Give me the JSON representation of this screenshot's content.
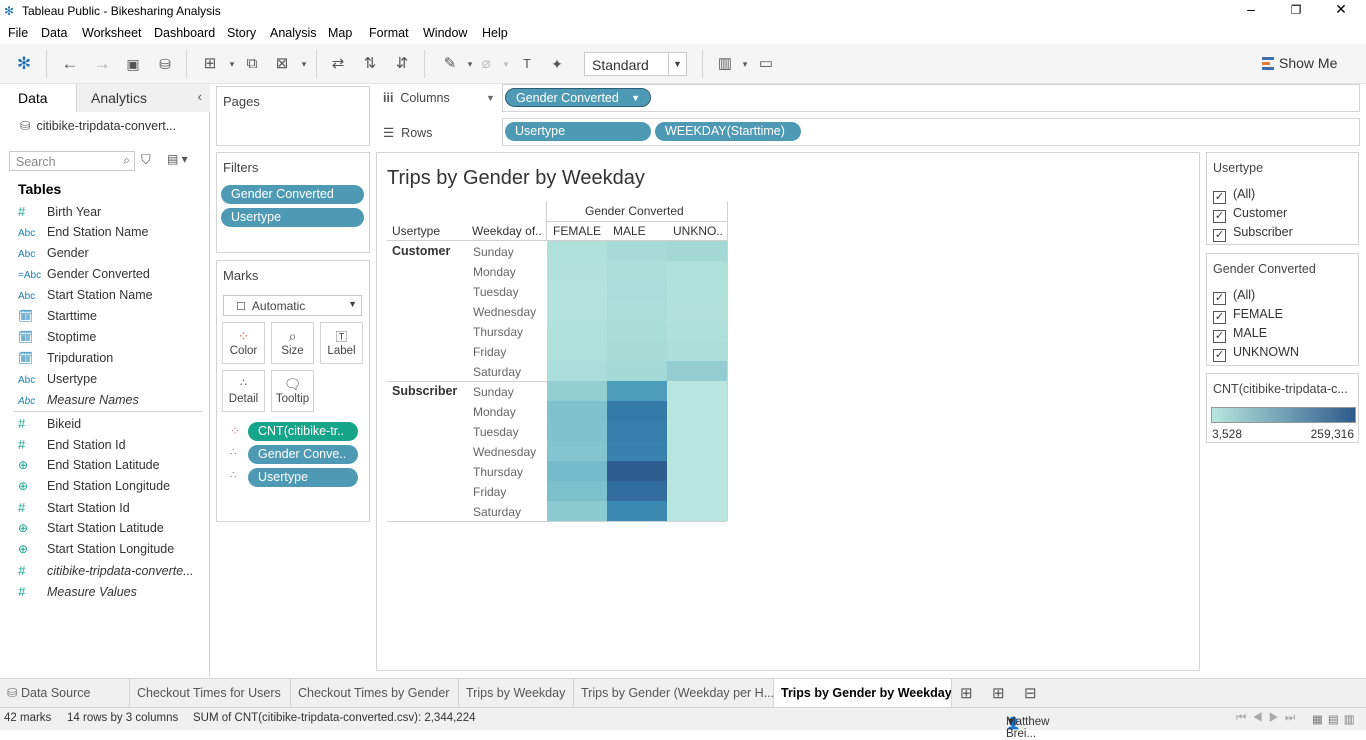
{
  "window": {
    "title": "Tableau Public - Bikesharing Analysis",
    "minimize": "–",
    "restore": "❐",
    "close": "✕"
  },
  "menu": [
    "File",
    "Data",
    "Worksheet",
    "Dashboard",
    "Story",
    "Analysis",
    "Map",
    "Format",
    "Window",
    "Help"
  ],
  "toolbar": {
    "fit": "Standard",
    "show_me": "Show Me"
  },
  "data_pane": {
    "tab_data": "Data",
    "tab_analytics": "Analytics",
    "datasource": "citibike-tripdata-convert...",
    "search_placeholder": "Search",
    "tables_heading": "Tables",
    "dimensions": [
      {
        "type": "num",
        "glyph": "#",
        "name": "Birth Year"
      },
      {
        "type": "str",
        "glyph": "Abc",
        "name": "End Station Name"
      },
      {
        "type": "str",
        "glyph": "Abc",
        "name": "Gender"
      },
      {
        "type": "str",
        "glyph": "=Abc",
        "name": "Gender Converted"
      },
      {
        "type": "str",
        "glyph": "Abc",
        "name": "Start Station Name"
      },
      {
        "type": "dt",
        "glyph": "🗓",
        "name": "Starttime"
      },
      {
        "type": "dt",
        "glyph": "🗓",
        "name": "Stoptime"
      },
      {
        "type": "dt",
        "glyph": "🗓",
        "name": "Tripduration"
      },
      {
        "type": "str",
        "glyph": "Abc",
        "name": "Usertype"
      },
      {
        "type": "str",
        "glyph": "Abc",
        "name": "Measure Names",
        "italic": true
      }
    ],
    "measures": [
      {
        "type": "num",
        "glyph": "#",
        "name": "Bikeid"
      },
      {
        "type": "num",
        "glyph": "#",
        "name": "End Station Id"
      },
      {
        "type": "geo",
        "glyph": "⊕",
        "name": "End Station Latitude"
      },
      {
        "type": "geo",
        "glyph": "⊕",
        "name": "End Station Longitude"
      },
      {
        "type": "num",
        "glyph": "#",
        "name": "Start Station Id"
      },
      {
        "type": "geo",
        "glyph": "⊕",
        "name": "Start Station Latitude"
      },
      {
        "type": "geo",
        "glyph": "⊕",
        "name": "Start Station Longitude"
      },
      {
        "type": "num",
        "glyph": "#",
        "name": "citibike-tripdata-converte...",
        "italic": true
      },
      {
        "type": "num",
        "glyph": "#",
        "name": "Measure Values",
        "italic": true
      }
    ]
  },
  "pages": {
    "heading": "Pages"
  },
  "filters": {
    "heading": "Filters",
    "items": [
      "Gender Converted",
      "Usertype"
    ]
  },
  "marks": {
    "heading": "Marks",
    "type": "Automatic",
    "buttons": [
      "Color",
      "Size",
      "Label",
      "Detail",
      "Tooltip"
    ],
    "pills": [
      "CNT(citibike-tr..",
      "Gender Conve..",
      "Usertype"
    ]
  },
  "columns": {
    "label": "Columns",
    "pill": "Gender Converted"
  },
  "rows": {
    "label": "Rows",
    "pills": [
      "Usertype",
      "WEEKDAY(Starttime)"
    ]
  },
  "viz": {
    "title": "Trips by Gender by Weekday",
    "col_group_header": "Gender Converted",
    "row_header_1": "Usertype",
    "row_header_2": "Weekday of..",
    "columns": [
      "FEMALE",
      "MALE",
      "UNKNO.."
    ],
    "groups": [
      {
        "name": "Customer",
        "days": [
          "Sunday",
          "Monday",
          "Tuesday",
          "Wednesday",
          "Thursday",
          "Friday",
          "Saturday"
        ],
        "colors": [
          [
            "#b0e1db",
            "#a7dbd7",
            "#a3d8d5"
          ],
          [
            "#b3e2dc",
            "#addfda",
            "#b0e1db"
          ],
          [
            "#b4e2dc",
            "#abdeda",
            "#b2e2dc"
          ],
          [
            "#b4e3dd",
            "#acdeda",
            "#b3e2dc"
          ],
          [
            "#b1e1db",
            "#a9ddd8",
            "#afe0db"
          ],
          [
            "#b1e1db",
            "#a8dcd7",
            "#addfda"
          ],
          [
            "#abdeda",
            "#a2d8d5",
            "#93cdd2"
          ]
        ]
      },
      {
        "name": "Subscriber",
        "days": [
          "Sunday",
          "Monday",
          "Tuesday",
          "Wednesday",
          "Thursday",
          "Friday",
          "Saturday"
        ],
        "colors": [
          [
            "#92cdd2",
            "#4b9dbb",
            "#b8e6de"
          ],
          [
            "#7ec2cd",
            "#347ba8",
            "#b8e6de"
          ],
          [
            "#7fc3ce",
            "#377fab",
            "#b8e6de"
          ],
          [
            "#82c5ce",
            "#3883ad",
            "#b8e6de"
          ],
          [
            "#74bcca",
            "#2e5f90",
            "#b8e6de"
          ],
          [
            "#7ac1cc",
            "#316c9c",
            "#b8e6de"
          ],
          [
            "#8ccad1",
            "#3a8ab1",
            "#b8e6de"
          ]
        ]
      }
    ]
  },
  "legends": {
    "usertype": {
      "title": "Usertype",
      "items": [
        "(All)",
        "Customer",
        "Subscriber"
      ]
    },
    "gender": {
      "title": "Gender Converted",
      "items": [
        "(All)",
        "FEMALE",
        "MALE",
        "UNKNOWN"
      ]
    },
    "color": {
      "title": "CNT(citibike-tripdata-c...",
      "min": "3,528",
      "max": "259,316"
    }
  },
  "sheets": [
    "Data Source",
    "Checkout Times for Users",
    "Checkout Times by Gender",
    "Trips by Weekday",
    "Trips by Gender (Weekday per H...",
    "Trips by Gender by Weekday"
  ],
  "status": {
    "marks": "42 marks",
    "dims": "14 rows by 3 columns",
    "sum": "SUM of CNT(citibike-tripdata-converted.csv): 2,344,224",
    "user": "Matthew Brei..."
  }
}
